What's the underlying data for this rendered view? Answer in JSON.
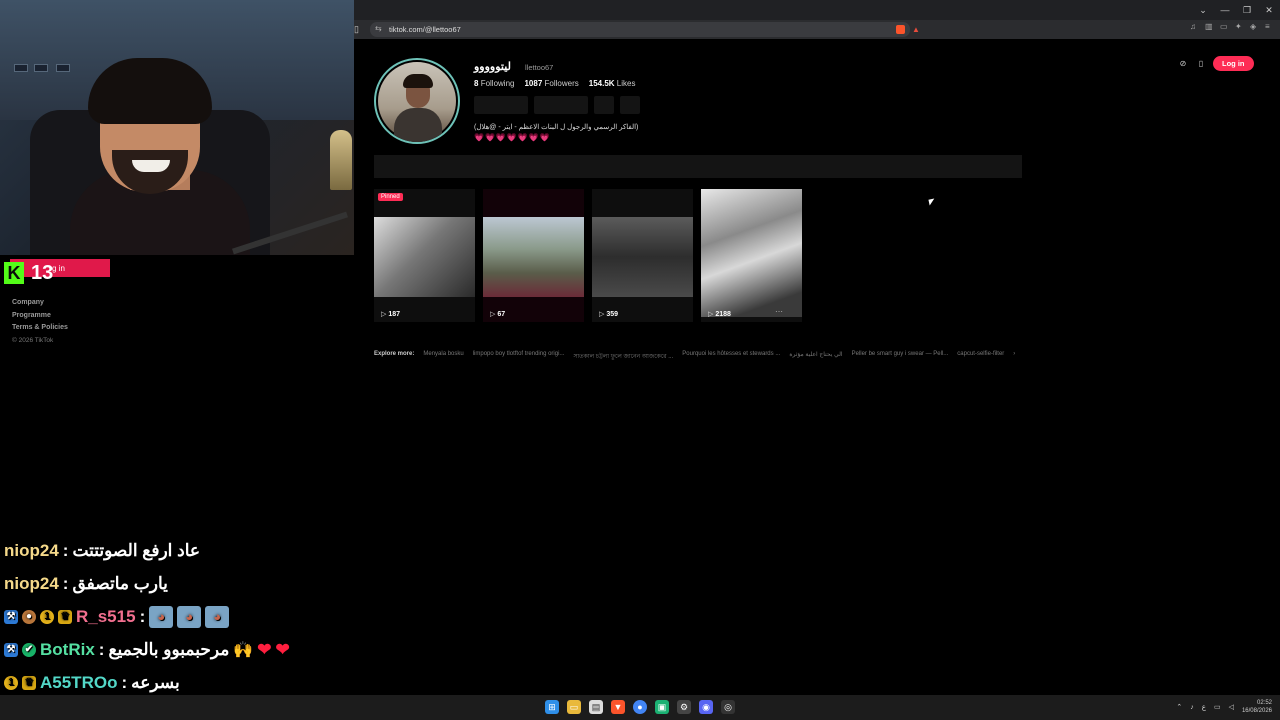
{
  "webcam": {
    "kick_logo": "K",
    "viewer_count": "13",
    "login_overlay": "g in",
    "footer_links": [
      "Company",
      "Programme",
      "Terms & Policies"
    ],
    "copyright": "© 2026 TikTok"
  },
  "browser": {
    "url": "tiktok.com/@llettoo67",
    "controls": [
      "⌄",
      "—",
      "❐",
      "✕"
    ]
  },
  "profile": {
    "display_name": "ليتووووو",
    "username": "llettoo67",
    "following_count": "8",
    "following_label": "Following",
    "followers_count": "1087",
    "followers_label": "Followers",
    "likes_count": "154.5K",
    "likes_label": "Likes",
    "bio": "(الفاكر الرسمي والرجول ل البنات الاعظم - ايتر - @هلال)",
    "hearts": "💗💗💗💗💗💗💗",
    "login_button": "Log in"
  },
  "videos": [
    {
      "views": "187",
      "pinned": true,
      "pinned_label": "Pinned"
    },
    {
      "views": "67"
    },
    {
      "views": "359"
    },
    {
      "views": "2188",
      "more": "⋯"
    }
  ],
  "explore": {
    "label": "Explore more:",
    "items": [
      "Menyala bosku",
      "limpopo boy tlotftof trending origi...",
      "সাতকাল চট্টলা ফুলে জানেন আজকেরে ...",
      "Pourquoi les hôtesses et stewards ...",
      "الي يحتاج اعلية مؤثرة",
      "Peller be smart guy i swear — Pell...",
      "capcut-selfie-filter"
    ],
    "arrow": "›"
  },
  "chat": [
    {
      "user": "niop24",
      "user_color": "#f5d98a",
      "sep": " : ",
      "message": "عاد ارفع الصوتتتت",
      "badges": []
    },
    {
      "user": "niop24",
      "user_color": "#f5d98a",
      "sep": " : ",
      "message": "يارب ماتصفق",
      "badges": []
    },
    {
      "user": "R_s515",
      "user_color": "#f26f8f",
      "sep": " : ",
      "message": "",
      "badges": [
        "blue",
        "cookie",
        "gold",
        "crown"
      ],
      "emotes": 3
    },
    {
      "user": "BotRix",
      "user_color": "#55e0a2",
      "sep": " : ",
      "message": "مرحبمبوو بالجميع",
      "badges": [
        "blue",
        "green"
      ],
      "extras": [
        "🙌",
        "❤",
        "❤"
      ]
    },
    {
      "user": "A55TROo",
      "user_color": "#53d8c8",
      "sep": " : ",
      "message": "بسرعه",
      "badges": [
        "gold",
        "crown"
      ]
    }
  ],
  "taskbar": {
    "time": "02:52",
    "date": "16/08/2026"
  },
  "colors": {
    "tiktok_red": "#fe2c55",
    "kick_green": "#53fc18"
  }
}
